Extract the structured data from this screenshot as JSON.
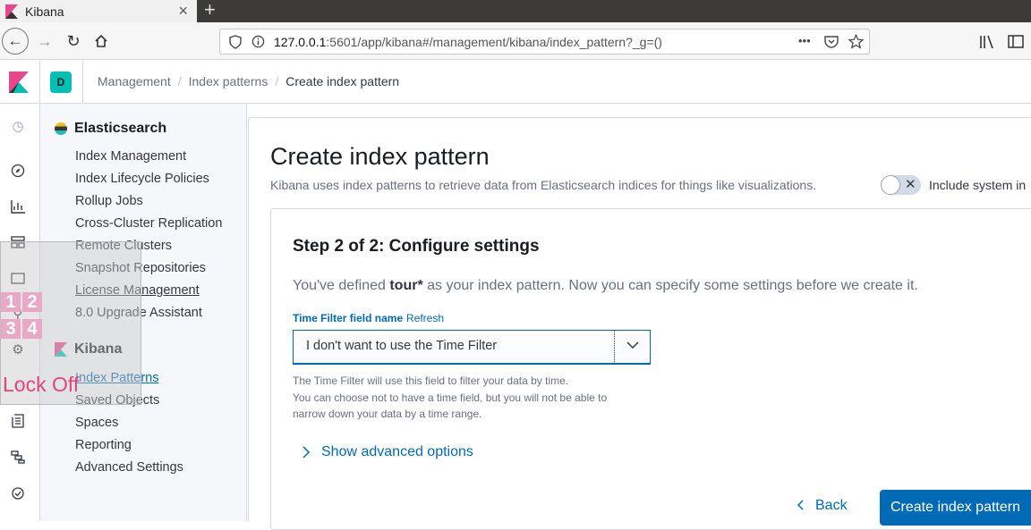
{
  "browser": {
    "tab_title": "Kibana",
    "tab_close": "×",
    "new_tab": "+",
    "url_host": "127.0.0.1",
    "url_rest": ":5601/app/kibana#/management/kibana/index_pattern?_g=()",
    "url_menu": "•••"
  },
  "header": {
    "space_initial": "D",
    "breadcrumbs": [
      "Management",
      "Index patterns",
      "Create index pattern"
    ]
  },
  "sidebar": {
    "elasticsearch_title": "Elasticsearch",
    "elasticsearch_items": [
      "Index Management",
      "Index Lifecycle Policies",
      "Rollup Jobs",
      "Cross-Cluster Replication",
      "Remote Clusters",
      "Snapshot Repositories",
      "License Management",
      "8.0 Upgrade Assistant"
    ],
    "kibana_title": "Kibana",
    "kibana_items": [
      "Index Patterns",
      "Saved Objects",
      "Spaces",
      "Reporting",
      "Advanced Settings"
    ]
  },
  "main": {
    "title": "Create index pattern",
    "description": "Kibana uses index patterns to retrieve data from Elasticsearch indices for things like visualizations.",
    "toggle_label": "Include system in",
    "step_title": "Step 2 of 2: Configure settings",
    "step_text_prefix": "You've defined ",
    "step_pattern": "tour*",
    "step_text_suffix": " as your index pattern. Now you can specify some settings before we create it.",
    "field_label": "Time Filter field name",
    "refresh_label": "Refresh",
    "select_value": "I don't want to use the Time Filter",
    "help_lines": [
      "The Time Filter will use this field to filter your data by time.",
      "You can choose not to have a time field, but you will not be able to",
      "narrow down your data by a time range."
    ],
    "advanced_label": "Show advanced options",
    "back_label": "Back",
    "create_label": "Create index pattern"
  },
  "overlay": {
    "numbers": [
      "1",
      "2",
      "3",
      "4"
    ],
    "lock_text": "Lock Off"
  }
}
